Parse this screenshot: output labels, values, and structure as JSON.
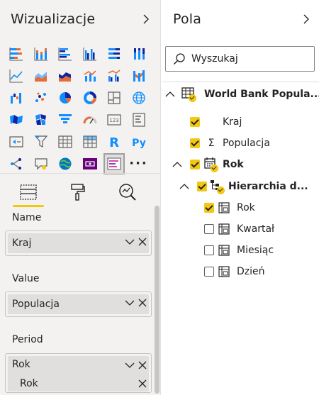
{
  "visualizations": {
    "title": "Wizualizacje",
    "collapse_icon": "chevron-right-icon",
    "icons": [
      "stacked-bar-chart-icon",
      "stacked-column-chart-icon",
      "clustered-bar-chart-icon",
      "clustered-column-chart-icon",
      "100-stacked-bar-chart-icon",
      "100-stacked-column-chart-icon",
      "line-chart-icon",
      "area-chart-icon",
      "stacked-area-chart-icon",
      "line-and-stacked-column-chart-icon",
      "line-and-clustered-column-chart-icon",
      "ribbon-chart-icon",
      "waterfall-chart-icon",
      "scatter-chart-icon",
      "pie-chart-icon",
      "donut-chart-icon",
      "treemap-icon",
      "map-icon",
      "filled-map-icon",
      "shape-map-icon",
      "funnel-icon",
      "gauge-icon",
      "card-icon",
      "multi-row-card-icon",
      "kpi-icon",
      "slicer-icon",
      "table-icon",
      "matrix-icon",
      "r-script-visual-icon",
      "python-visual-icon",
      "key-influencers-icon",
      "qna-icon",
      "arcgis-map-icon",
      "custom-visual-icon",
      "selected-custom-visual-icon",
      "more-visuals-icon"
    ],
    "more_label": "···",
    "tabs": [
      {
        "name": "fields-tab-icon"
      },
      {
        "name": "format-tab-icon"
      },
      {
        "name": "analytics-tab-icon"
      }
    ],
    "wells": [
      {
        "label": "Name",
        "fields": [
          {
            "value": "Kraj"
          }
        ]
      },
      {
        "label": "Value",
        "fields": [
          {
            "value": "Populacja"
          }
        ]
      },
      {
        "label": "Period",
        "fields": [
          {
            "value": "Rok",
            "sub": "Rok"
          }
        ]
      }
    ]
  },
  "fields_pane": {
    "title": "Pola",
    "collapse_icon": "chevron-right-icon",
    "search_placeholder": "Wyszukaj",
    "table": "World Bank Popula...",
    "items": {
      "kraj": "Kraj",
      "populacja": "Populacja",
      "rok_table": "Rok",
      "hierarchy": "Hierarchia d...",
      "rok": "Rok",
      "kwartal": "Kwartał",
      "miesiac": "Miesiąc",
      "dzien": "Dzień"
    }
  },
  "colors": {
    "accent": "#f2c811",
    "pane_bg": "#f3f2f1",
    "pill_bg": "#e1dfdd",
    "chart_blue": "#118dff",
    "chart_navy": "#12239e",
    "chart_orange": "#e66c37",
    "chart_purple": "#6b007b"
  }
}
